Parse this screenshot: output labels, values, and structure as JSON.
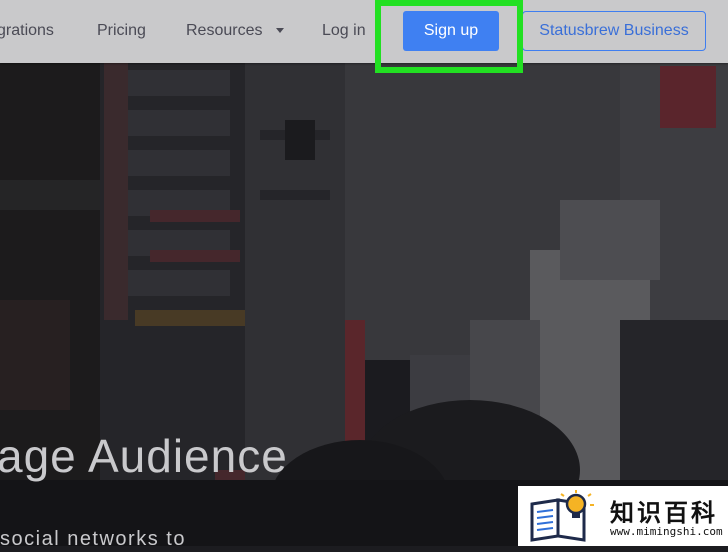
{
  "nav": {
    "integrations_label": "grations",
    "pricing_label": "Pricing",
    "resources_label": "Resources",
    "login_label": "Log in",
    "signup_label": "Sign up",
    "business_label": "Statusbrew Business"
  },
  "hero": {
    "title": "age Audience",
    "subtitle": "social networks to"
  },
  "watermark": {
    "title": "知识百科",
    "url": "www.mimingshi.com"
  },
  "colors": {
    "navbar_bg": "#c9c9cb",
    "signup_button": "#3f80f2",
    "highlight": "#22e022",
    "business_border": "#3f7ef0"
  },
  "icons": [
    "caret-down-icon",
    "book-lightbulb-logo-icon"
  ]
}
